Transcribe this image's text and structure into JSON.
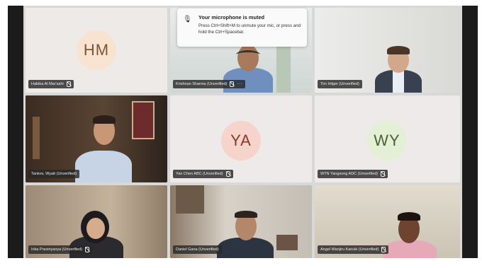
{
  "notification": {
    "title": "Your microphone is muted",
    "body": "Press Ctrl+Shift+M to unmute your mic, or press and hold the Ctrl+Spacebar.",
    "icon": "mic-muted-icon"
  },
  "participants": [
    {
      "initials": "HM",
      "name": "Habiba Al Mar'ashi",
      "type": "avatar",
      "avatar_bg": "#f7e3cf",
      "avatar_fg": "#7a5636"
    },
    {
      "initials": "",
      "name": "Krishnan Sharma (Unverified)",
      "type": "video"
    },
    {
      "initials": "",
      "name": "Tim Hilger (Unverified)",
      "type": "video"
    },
    {
      "initials": "",
      "name": "Tankov, Wyatt (Unverified)",
      "type": "video",
      "active": true
    },
    {
      "initials": "YA",
      "name": "Yan Chen ABC (Unverified)",
      "type": "avatar",
      "avatar_bg": "#f6d3cb",
      "avatar_fg": "#8a3a2a"
    },
    {
      "initials": "WY",
      "name": "WTN Yangsong ADC (Unverified)",
      "type": "avatar",
      "avatar_bg": "#e4f0d6",
      "avatar_fg": "#4a6134"
    },
    {
      "initials": "",
      "name": "Irika Pravinyanya (Unverified)",
      "type": "video"
    },
    {
      "initials": "",
      "name": "Daniel Gana (Unverified)",
      "type": "video"
    },
    {
      "initials": "",
      "name": "Angel Wanjiru Kariuki (Unverified)",
      "type": "video"
    }
  ],
  "colors": {
    "active_outline": "#6f6bc9",
    "label_bg": "#2a2a2a",
    "tile_bg": "#ececec"
  }
}
